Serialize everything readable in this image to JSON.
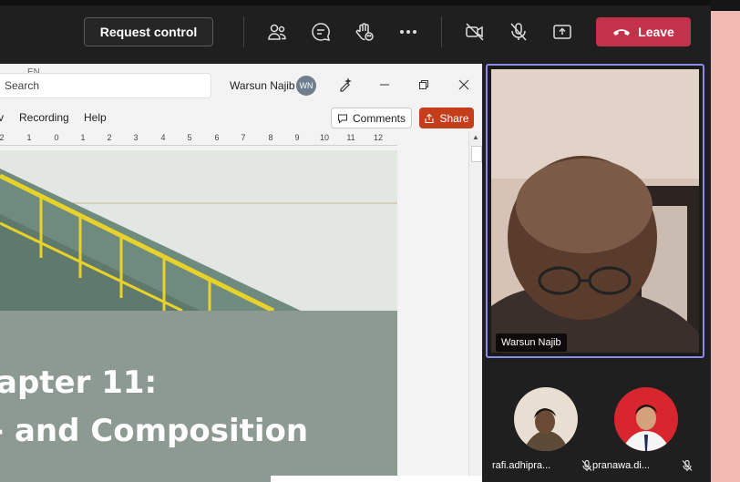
{
  "toolbar": {
    "request_control_label": "Request control",
    "leave_label": "Leave",
    "icons": [
      "people-icon",
      "chat-icon",
      "raise-hand-icon",
      "more-options-icon",
      "camera-off-icon",
      "mic-off-icon",
      "share-screen-icon",
      "phone-hangup-icon"
    ],
    "leave_color": "#c4314b"
  },
  "shared_window": {
    "app": "Word",
    "language_indicator": "EN",
    "search_placeholder": "Search",
    "user_name": "Warsun Najib",
    "user_initials": "WN",
    "menu": {
      "partial_tab": "v",
      "recording": "Recording",
      "help": "Help"
    },
    "comments_label": "Comments",
    "share_label": "Share",
    "share_color": "#c43e1c",
    "ruler_ticks": [
      "2",
      "1",
      "0",
      "1",
      "2",
      "3",
      "4",
      "5",
      "6",
      "7",
      "8",
      "9",
      "10",
      "11",
      "12"
    ],
    "document": {
      "title_line1": "apter 11:",
      "title_line2": "- and Composition"
    }
  },
  "participants": {
    "main": {
      "name": "Warsun Najib",
      "border_color": "#8b8ce8"
    },
    "others": [
      {
        "name": "rafi.adhipra...",
        "muted": true
      },
      {
        "name": "pranawa.di...",
        "muted": true
      }
    ]
  }
}
